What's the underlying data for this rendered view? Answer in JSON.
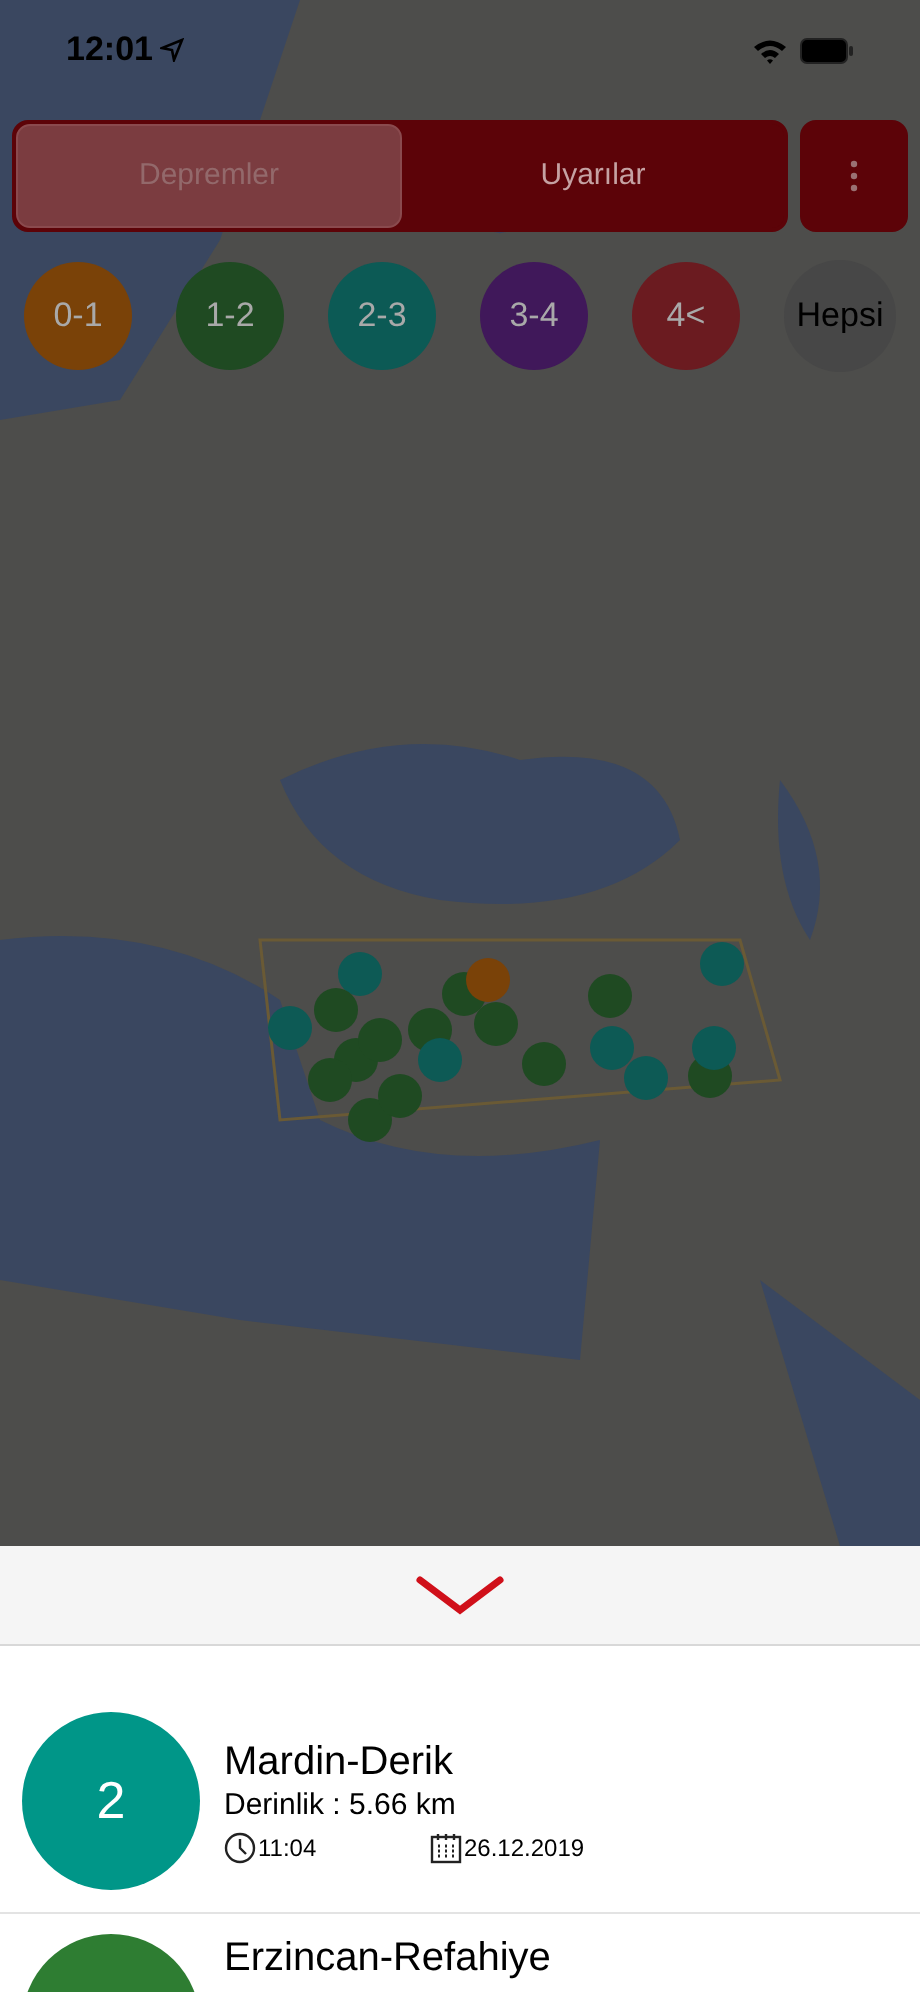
{
  "status_bar": {
    "time": "12:01"
  },
  "segments": [
    {
      "label": "Depremler",
      "selected": true
    },
    {
      "label": "Uyarılar",
      "selected": false
    }
  ],
  "magnitude_filters": [
    {
      "label": "0-1",
      "color": "#7a4208"
    },
    {
      "label": "1-2",
      "color": "#1f4a22"
    },
    {
      "label": "2-3",
      "color": "#0c5a55"
    },
    {
      "label": "3-4",
      "color": "#40185a"
    },
    {
      "label": "4<",
      "color": "#6b1b20"
    },
    {
      "label": "Hepsi",
      "color": "#474747"
    }
  ],
  "earthquakes": [
    {
      "magnitude": "2",
      "place": "Mardin-Derik",
      "depth": "Derinlik : 5.66 km",
      "time": "11:04",
      "date": "26.12.2019",
      "color": "#009688"
    },
    {
      "place": "Erzincan-Refahiye",
      "color": "#2e7d32"
    }
  ]
}
